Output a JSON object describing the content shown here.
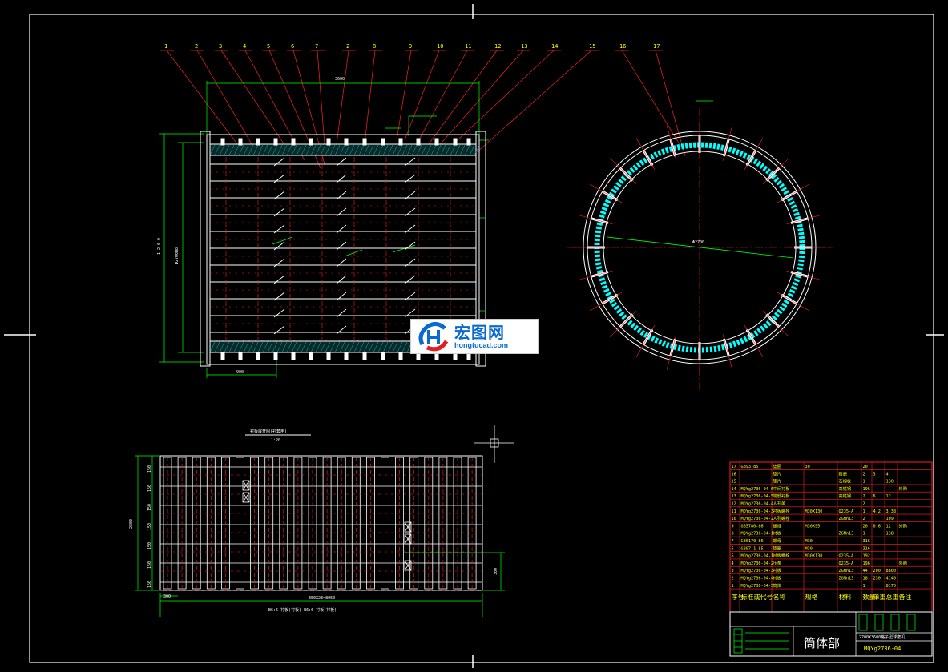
{
  "drawing": {
    "title": "筒体部",
    "drawing_no": "MQYg2736-04",
    "project": "2700X3600格子型球磨机",
    "dim_length_top": "3600",
    "dim_diameter_left": "1 2 0 0",
    "dim_left_inner": "Φ2700H8",
    "dim_bottom_900": "900",
    "dim_ring": "Φ2700",
    "layout_scale": "1:20",
    "layout_title": "衬板展开图(衬套用)",
    "layout_height": "2800",
    "layout_total": "350X23=8050",
    "layout_left": "300",
    "layout_bottom": "B6:6-衬板(衬板) B6:6-衬板(衬板)",
    "layout_right": "300",
    "layout_dims": [
      "150",
      "150",
      "150",
      "150",
      "150",
      "150",
      "150"
    ]
  },
  "callouts": [
    "1",
    "2",
    "3",
    "4",
    "5",
    "6",
    "7",
    "2",
    "8",
    "9",
    "10",
    "11",
    "12",
    "13",
    "14",
    "15",
    "16",
    "17"
  ],
  "bom": {
    "header": [
      "序号",
      "标准或代号",
      "名称",
      "规格",
      "材料",
      "数量",
      "单重",
      "总重",
      "备注"
    ],
    "rows": [
      [
        "17",
        "GB93-85",
        "垫圈",
        "30",
        "",
        "20",
        "",
        "",
        ""
      ],
      [
        "16",
        "",
        "垫片",
        "",
        "耐磨",
        "2",
        "3",
        "4",
        ""
      ],
      [
        "15",
        "",
        "垫片",
        "",
        "石棉板",
        "1",
        "",
        "130",
        ""
      ],
      [
        "14",
        "MQYg2736-04-6",
        "中间衬板",
        "",
        "高锰钢",
        "196",
        "",
        "",
        "外购"
      ],
      [
        "13",
        "MQYg2736-04-5",
        "端部衬板",
        "",
        "高锰钢",
        "2",
        "6",
        "12",
        ""
      ],
      [
        "12",
        "MQYg2736-04-4",
        "人孔盖",
        "",
        "",
        "2",
        "",
        "",
        ""
      ],
      [
        "11",
        "MQYg2736-04-3",
        "衬板螺栓",
        "M30X130",
        "Q235-A",
        "1",
        "4.2",
        "3.38",
        ""
      ],
      [
        "10",
        "MQYg2736-04-2",
        "人孔螺栓",
        "",
        "ZGMn13",
        "2",
        "",
        "109",
        ""
      ],
      [
        "9",
        "GB5780-86",
        "螺栓",
        "M30X95",
        "",
        "20",
        "0.6",
        "12",
        "外购"
      ],
      [
        "8",
        "MQYg2736-04-1",
        "衬板",
        "",
        "ZGMn13",
        "1",
        "",
        "138",
        ""
      ],
      [
        "7",
        "GB6170-86",
        "螺母",
        "M30",
        "",
        "316",
        "",
        "",
        ""
      ],
      [
        "6",
        "GB97.1-85",
        "垫圈",
        "M30",
        "",
        "316",
        "",
        "",
        ""
      ],
      [
        "5",
        "MQYg2736-04-1",
        "衬板螺栓",
        "M30X130",
        "Q235-A",
        "192",
        "",
        "",
        ""
      ],
      [
        "4",
        "MQYg2736-04-2",
        "压条",
        "",
        "Q235-A",
        "196",
        "",
        "",
        "外购"
      ],
      [
        "3",
        "MQYg2736-04-3",
        "衬板",
        "",
        "ZGMn13",
        "44",
        "200",
        "8800",
        ""
      ],
      [
        "2",
        "MQYg2736-04-4",
        "衬板",
        "",
        "ZGMn13",
        "18",
        "230",
        "4140",
        ""
      ],
      [
        "1",
        "MQYg2736-04-5",
        "筒体",
        "",
        "",
        "1",
        "",
        "8170",
        ""
      ]
    ]
  },
  "watermark": {
    "cn": "宏图网",
    "en": "hongtucad.com"
  },
  "colors": {
    "background": "#000000",
    "outline": "#ffffff",
    "dimension": "#00ff00",
    "leader": "#ff0000",
    "center": "#ff0000",
    "hatch": "#00ffff",
    "table": "#ff0000",
    "table_text": "#ffff00",
    "watermark_blue": "#0a6ad1",
    "watermark_red": "#e02020"
  }
}
